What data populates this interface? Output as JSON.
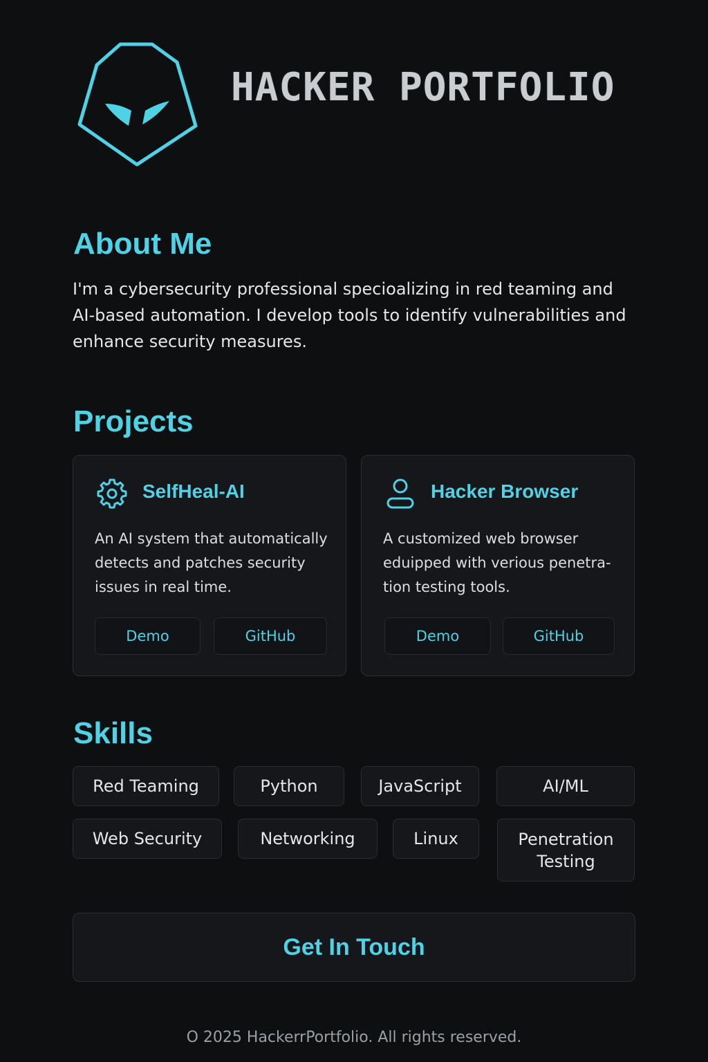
{
  "header": {
    "title": "HACKER PORTFOLIO",
    "logo_icon": "hooded-hacker-icon"
  },
  "theme": {
    "accent": "#4fd1e6",
    "background": "#0e0f10",
    "card_background": "#15171a"
  },
  "about": {
    "heading": "About Me",
    "text": "I'm a cybersecurity professional specioalizing in red teaming and AI-based automation. I develop tools to identify vulnerabilities and enhance security measures."
  },
  "projects": {
    "heading": "Projects",
    "items": [
      {
        "icon": "gear-icon",
        "title": "SelfHeal-AI",
        "description": "An AI system that automatically detects and patches security issues in real time.",
        "demo_label": "Demo",
        "github_label": "GitHub"
      },
      {
        "icon": "user-icon",
        "title": "Hacker Browser",
        "description": "A customized web browser eduipped with verious penetra-tion testing tools.",
        "demo_label": "Demo",
        "github_label": "GitHub"
      }
    ]
  },
  "skills": {
    "heading": "Skills",
    "items": [
      "Red Teaming",
      "Python",
      "JavaScript",
      "AI/ML",
      "Web Security",
      "Networking",
      "Linux",
      "Penetration Testing"
    ]
  },
  "cta": {
    "label": "Get In Touch"
  },
  "footer": {
    "text": "O 2025 HackerrPortfolio. All rights reserved."
  }
}
